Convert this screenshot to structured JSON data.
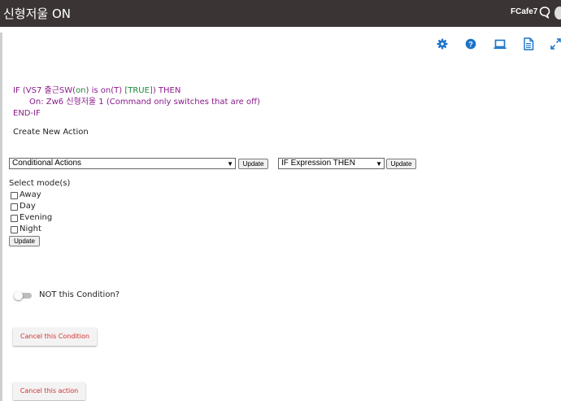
{
  "header": {
    "title": "신형저울 ON",
    "user": "FCafe7",
    "colors": {
      "background": "#3a3434",
      "text": "#ffffff"
    }
  },
  "toolbar": {
    "icons": [
      "gear-icon",
      "help-icon",
      "laptop-icon",
      "document-icon",
      "expand-icon"
    ],
    "accent": "#1a73c8"
  },
  "expression": {
    "line1_prefix": "IF (VS7 출근SW(",
    "line1_on": "on",
    "line1_mid": ") is on(T) ",
    "line1_true": "[TRUE]",
    "line1_suffix": ") THEN",
    "line2": "On: Zw6 신형저울 1 (Command only switches that are off)",
    "line3": "END-IF",
    "colors": {
      "main": "#8b1a8b",
      "highlight": "#1a8a3a"
    }
  },
  "create_action": {
    "title": "Create New Action",
    "action_select": {
      "value": "Conditional Actions"
    },
    "action_update_label": "Update",
    "expression_select": {
      "value": "IF Expression THEN"
    },
    "expression_update_label": "Update"
  },
  "modes": {
    "label": "Select mode(s)",
    "options": [
      {
        "label": "Away",
        "checked": false
      },
      {
        "label": "Day",
        "checked": false
      },
      {
        "label": "Evening",
        "checked": false
      },
      {
        "label": "Night",
        "checked": false
      }
    ],
    "update_label": "Update"
  },
  "condition_toggle": {
    "label": "NOT this Condition?",
    "on": false
  },
  "buttons": {
    "cancel_condition": "Cancel this Condition",
    "cancel_action": "Cancel this action",
    "color": "#d32f2f"
  }
}
